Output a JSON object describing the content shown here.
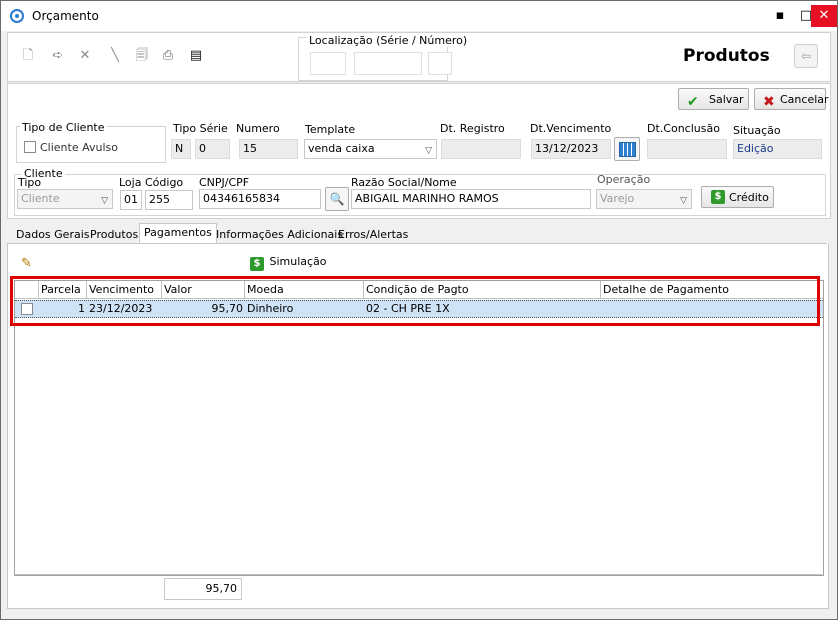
{
  "window": {
    "title": "Orçamento",
    "minimize": "▪",
    "maximize": "□",
    "close": "✕"
  },
  "toolbar": {
    "icons": [
      "new-doc-icon",
      "edit-icon",
      "delete-icon",
      "pencil-icon",
      "preview-icon",
      "print-icon",
      "copy-icon"
    ],
    "localizacao_label": "Localização (Série / Número)",
    "section_title": "Produtos"
  },
  "actions": {
    "save_label": "Salvar",
    "cancel_label": "Cancelar"
  },
  "header": {
    "tipo_cliente_label": "Tipo de Cliente",
    "cliente_avulso_label": "Cliente Avulso",
    "tipo_serie_label": "Tipo Série",
    "tipo_serie_value": "N",
    "serie_value": "0",
    "numero_label": "Numero",
    "numero_value": "15",
    "template_label": "Template",
    "template_value": "venda caixa",
    "dt_registro_label": "Dt. Registro",
    "dt_registro_value": "",
    "dt_vencimento_label": "Dt.Vencimento",
    "dt_vencimento_value": "13/12/2023",
    "dt_conclusao_label": "Dt.Conclusão",
    "dt_conclusao_value": "",
    "situacao_label": "Situação",
    "situacao_value": "Edição"
  },
  "cliente": {
    "group_label": "Cliente",
    "tipo_label": "Tipo",
    "tipo_value": "Cliente",
    "loja_label": "Loja",
    "loja_value": "01",
    "codigo_label": "Código",
    "codigo_value": "255",
    "cnpj_label": "CNPJ/CPF",
    "cnpj_value": "04346165834",
    "razao_label": "Razão Social/Nome",
    "razao_value": "ABIGAIL MARINHO RAMOS",
    "operacao_label": "Operação",
    "operacao_value": "Varejo",
    "credito_label": "Crédito"
  },
  "tabs": [
    {
      "label": "Dados Gerais"
    },
    {
      "label": "Produtos"
    },
    {
      "label": "Pagamentos"
    },
    {
      "label": "Informações Adicionais"
    },
    {
      "label": "Erros/Alertas"
    }
  ],
  "payments": {
    "simulacao_label": "Simulação",
    "columns": [
      "Parcela",
      "Vencimento",
      "Valor",
      "Moeda",
      "Condição de Pagto",
      "Detalhe de Pagamento"
    ],
    "rows": [
      {
        "parcela": "1",
        "vencimento": "23/12/2023",
        "valor": "95,70",
        "moeda": "Dinheiro",
        "condicao": "02 - CH PRE 1X",
        "detalhe": ""
      }
    ],
    "total": "95,70"
  },
  "colors": {
    "highlight": "#e00000",
    "selected_row": "#cfe3f7",
    "close_button": "#e81123"
  }
}
